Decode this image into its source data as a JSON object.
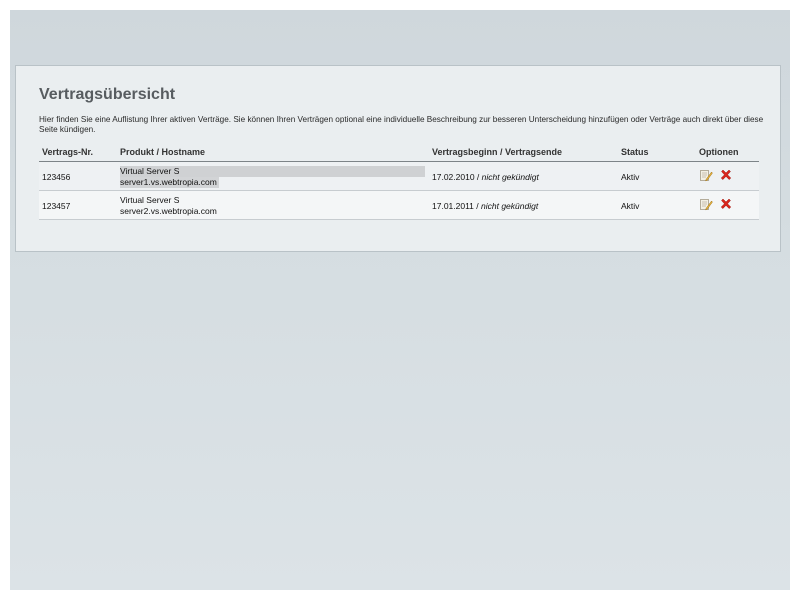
{
  "page": {
    "title": "Vertragsübersicht",
    "intro": "Hier finden Sie eine Auflistung Ihrer aktiven Verträge. Sie können Ihren Verträgen optional eine individuelle Beschreibung zur besseren Unterscheidung hinzufügen oder Verträge auch direkt über diese Seite kündigen."
  },
  "table": {
    "headers": {
      "nr": "Vertrags-Nr.",
      "product": "Produkt / Hostname",
      "dates": "Vertragsbeginn / Vertragsende",
      "status": "Status",
      "options": "Optionen"
    },
    "rows": [
      {
        "nr": "123456",
        "product": "Virtual Server S",
        "hostname": "server1.vs.webtropia.com",
        "start": "17.02.2010",
        "separator": " / ",
        "end": "nicht gekündigt",
        "status": "Aktiv"
      },
      {
        "nr": "123457",
        "product": "Virtual Server S",
        "hostname": "server2.vs.webtropia.com",
        "start": "17.01.2011",
        "separator": " / ",
        "end": "nicht gekündigt",
        "status": "Aktiv"
      }
    ]
  },
  "icons": {
    "edit": "edit-note-icon",
    "cancel": "delete-x-icon"
  },
  "colors": {
    "cancel_icon": "#d9261c",
    "title": "#575c60"
  }
}
